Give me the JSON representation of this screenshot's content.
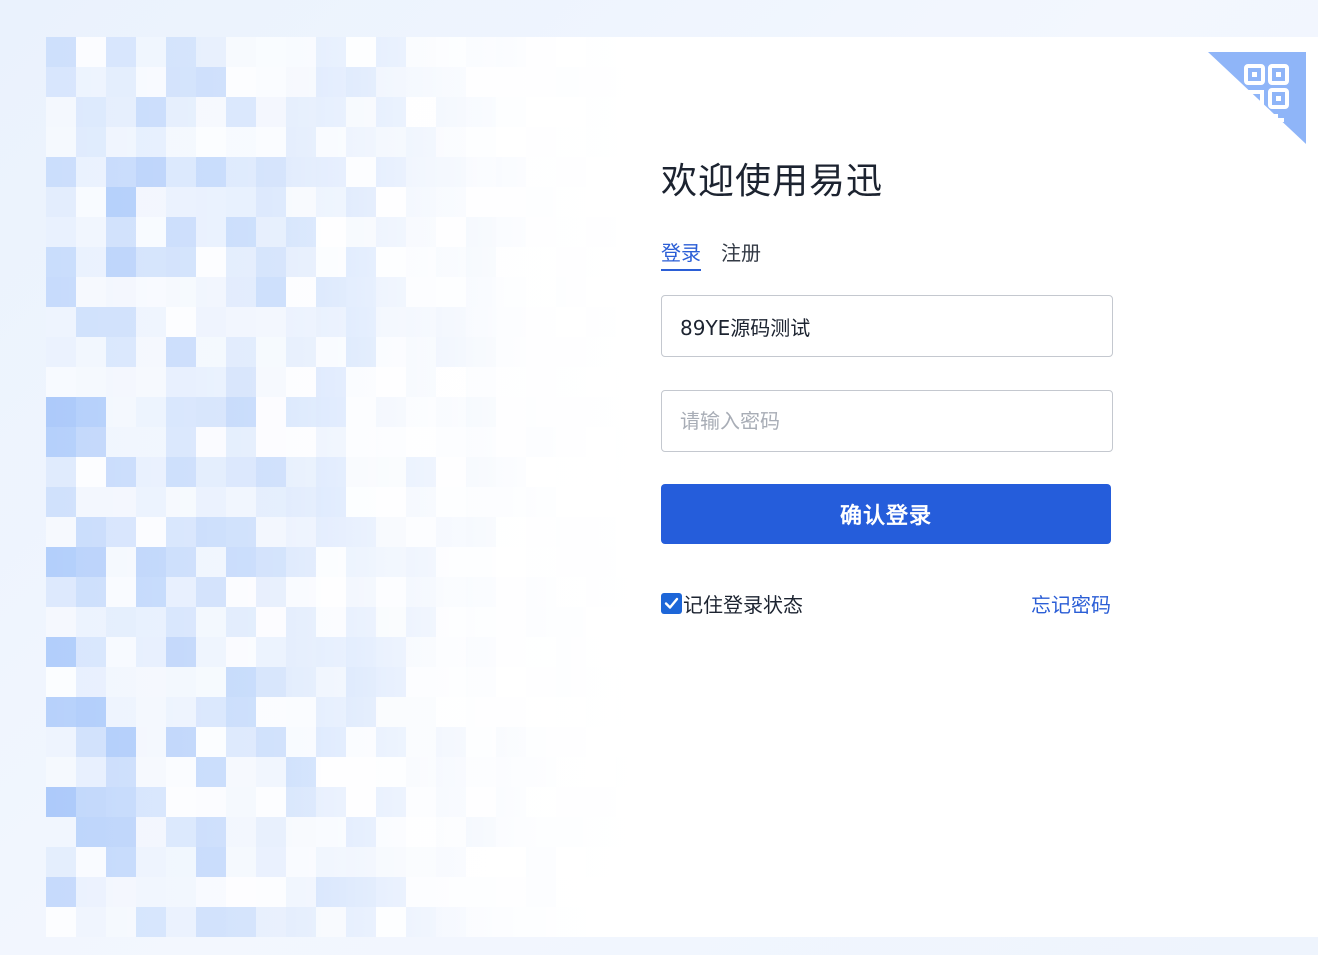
{
  "login": {
    "title": "欢迎使用易迅",
    "tabs": [
      {
        "label": "登录",
        "active": true
      },
      {
        "label": "注册",
        "active": false
      }
    ],
    "username": {
      "value": "89YE源码测试",
      "placeholder": ""
    },
    "password": {
      "value": "",
      "placeholder": "请输入密码"
    },
    "submit_label": "确认登录",
    "remember": {
      "label": "记住登录状态",
      "checked": true
    },
    "forgot_label": "忘记密码"
  },
  "icons": {
    "qr_corner": "qr-code-icon",
    "checkbox": "checkmark-icon"
  },
  "colors": {
    "primary": "#255ddb",
    "link": "#2b5ed6",
    "title": "#1c2330",
    "mosaic_blue": "#a9c8fa",
    "qr_badge": "#8fb5f8"
  }
}
